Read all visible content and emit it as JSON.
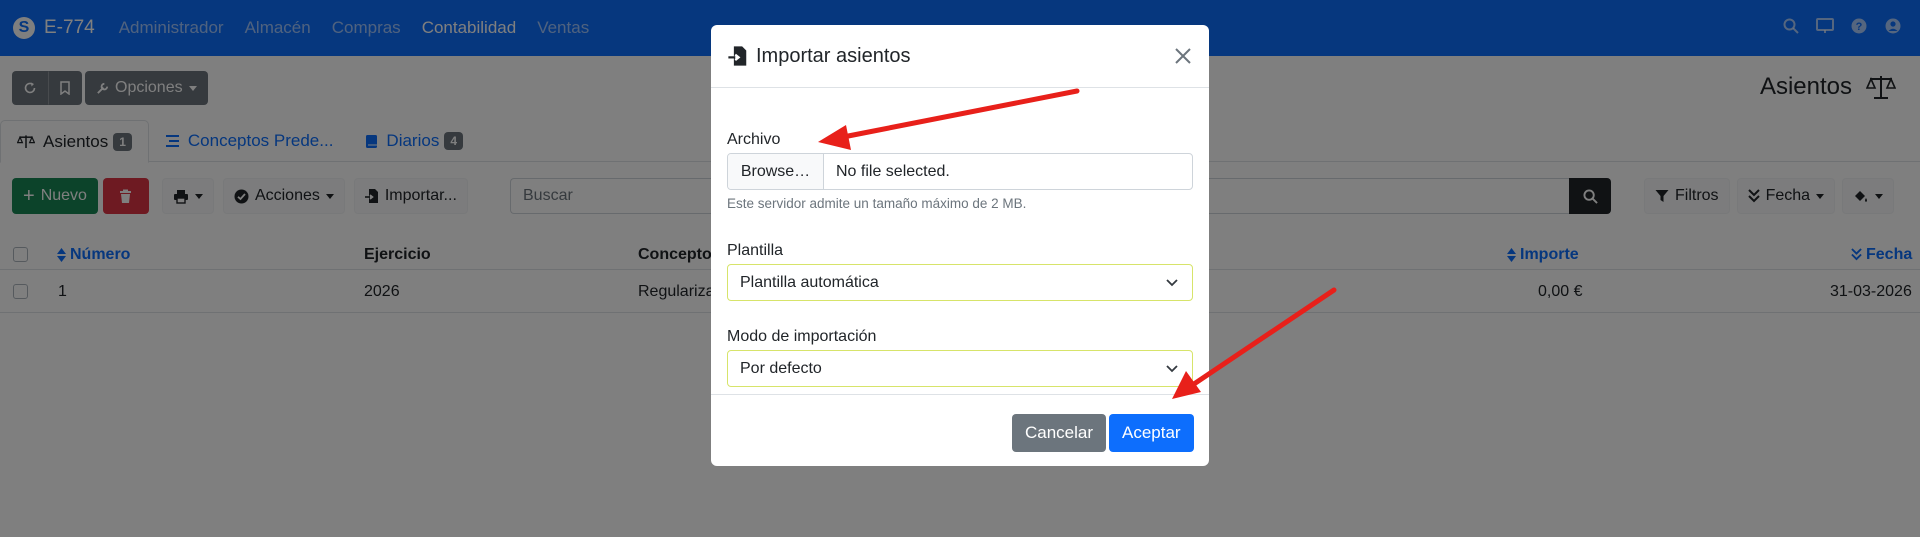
{
  "app": {
    "name": "E-774",
    "logo_glyph": "S"
  },
  "nav": {
    "items": [
      "Administrador",
      "Almacén",
      "Compras",
      "Contabilidad",
      "Ventas"
    ],
    "active": "Contabilidad"
  },
  "toolbar": {
    "options_label": "Opciones"
  },
  "page": {
    "title": "Asientos"
  },
  "tabs": [
    {
      "label": "Asientos",
      "badge": "1"
    },
    {
      "label": "Conceptos Prede..."
    },
    {
      "label": "Diarios",
      "badge": "4"
    }
  ],
  "actions": {
    "new_label": "Nuevo",
    "acciones_label": "Acciones",
    "import_label": "Importar...",
    "filters_label": "Filtros",
    "date_sort_label": "Fecha"
  },
  "search": {
    "placeholder": "Buscar"
  },
  "table": {
    "columns": {
      "numero": "Número",
      "ejercicio": "Ejercicio",
      "concepto": "Concepto",
      "importe": "Importe",
      "fecha": "Fecha"
    },
    "rows": [
      {
        "numero": "1",
        "ejercicio": "2026",
        "concepto": "Regulariza",
        "importe": "0,00 €",
        "fecha": "31-03-2026"
      }
    ]
  },
  "modal": {
    "title": "Importar asientos",
    "file_label": "Archivo",
    "browse_label": "Browse…",
    "file_status": "No file selected.",
    "file_help": "Este servidor admite un tamaño máximo de 2 MB.",
    "template_label": "Plantilla",
    "template_value": "Plantilla automática",
    "mode_label": "Modo de importación",
    "mode_value": "Por defecto",
    "cancel_label": "Cancelar",
    "accept_label": "Aceptar"
  },
  "colors": {
    "primary": "#0d6efd",
    "success": "#198754",
    "danger": "#dc3545",
    "secondary": "#6c757d",
    "annotation_arrow": "#e8201a"
  }
}
